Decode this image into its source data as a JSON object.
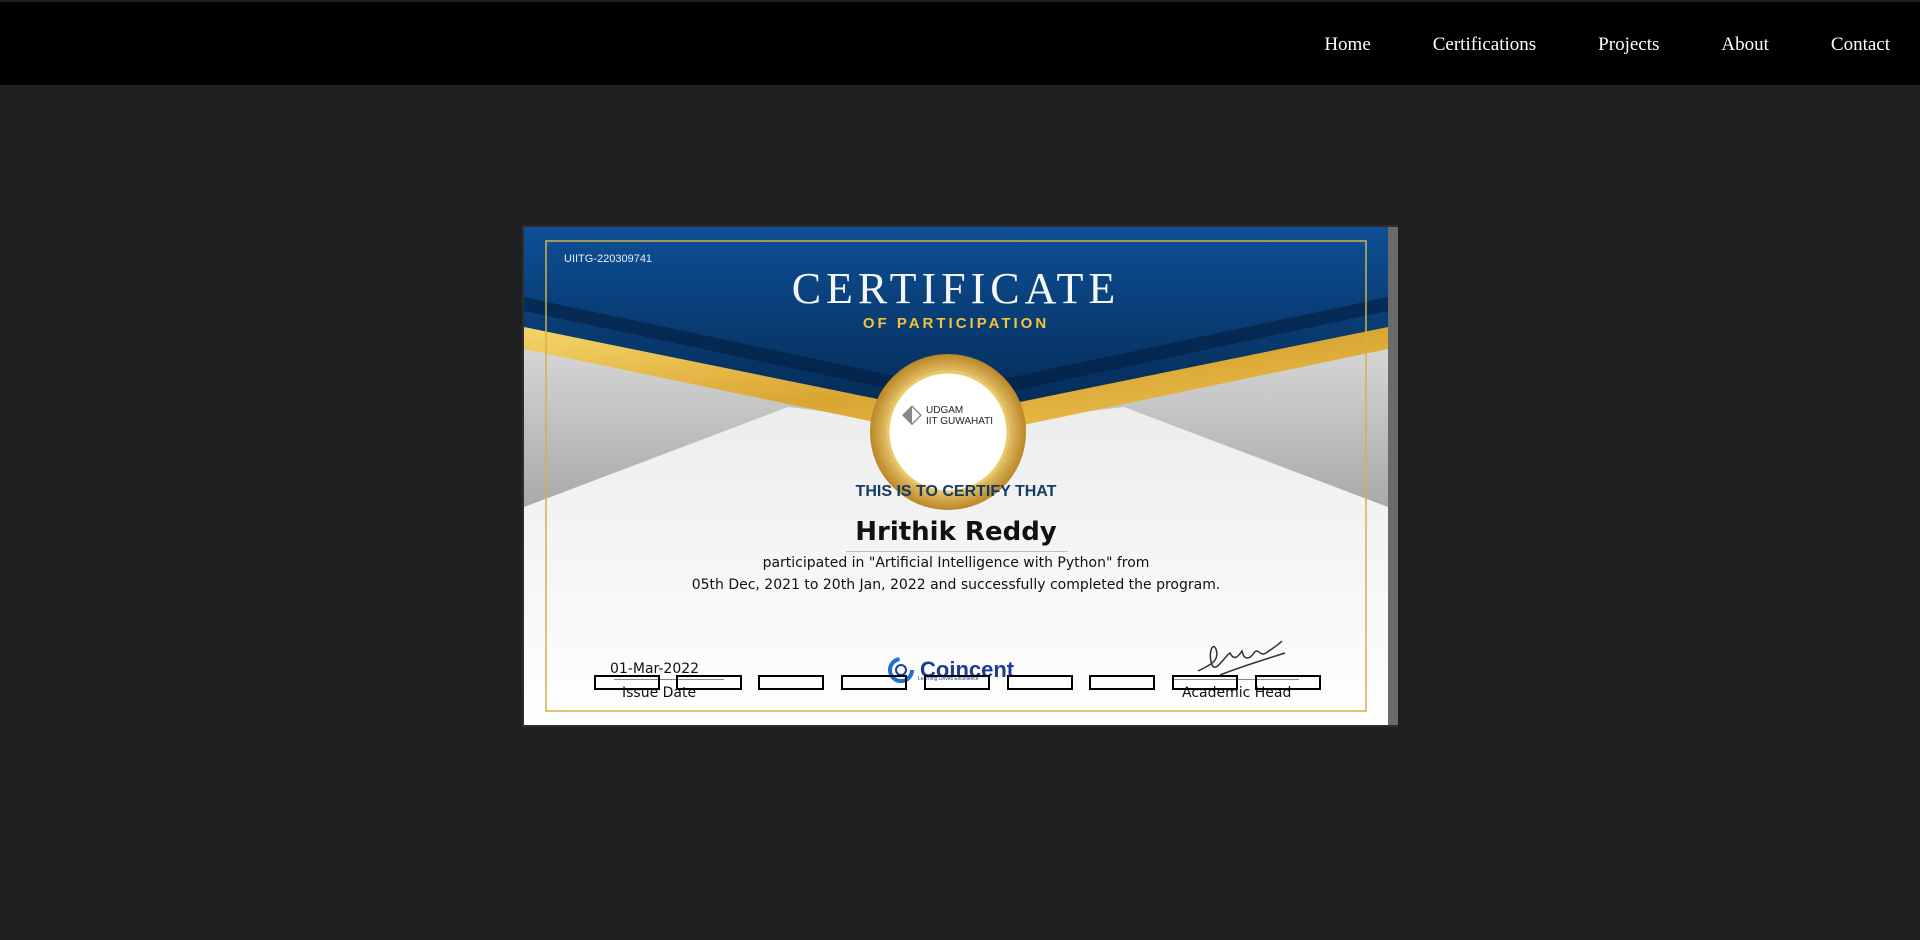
{
  "nav": {
    "items": [
      {
        "label": "Home"
      },
      {
        "label": "Certifications"
      },
      {
        "label": "Projects"
      },
      {
        "label": "About"
      },
      {
        "label": "Contact"
      }
    ]
  },
  "certificate": {
    "id": "UIITG-220309741",
    "title": "CERTIFICATE",
    "subtitle": "OF PARTICIPATION",
    "seal": {
      "line1": "UDGAM",
      "line2": "IIT GUWAHATI",
      "icon": "udgam-logo-icon"
    },
    "certify_line": "THIS IS TO CERTIFY THAT",
    "recipient": "Hrithik Reddy",
    "description_line1": "participated in \"Artificial Intelligence with Python\" from",
    "description_line2": "05th Dec, 2021 to 20th Jan, 2022 and successfully completed the program.",
    "issue_date": "01-Mar-2022",
    "issue_label": "Issue Date",
    "brand": {
      "name": "Coincent",
      "tagline": "Learning Drives Excellence"
    },
    "signer_label": "Academic Head",
    "colors": {
      "navy": "#0a3a78",
      "gold": "#e2b23a",
      "silver": "#c9c9c9"
    }
  }
}
